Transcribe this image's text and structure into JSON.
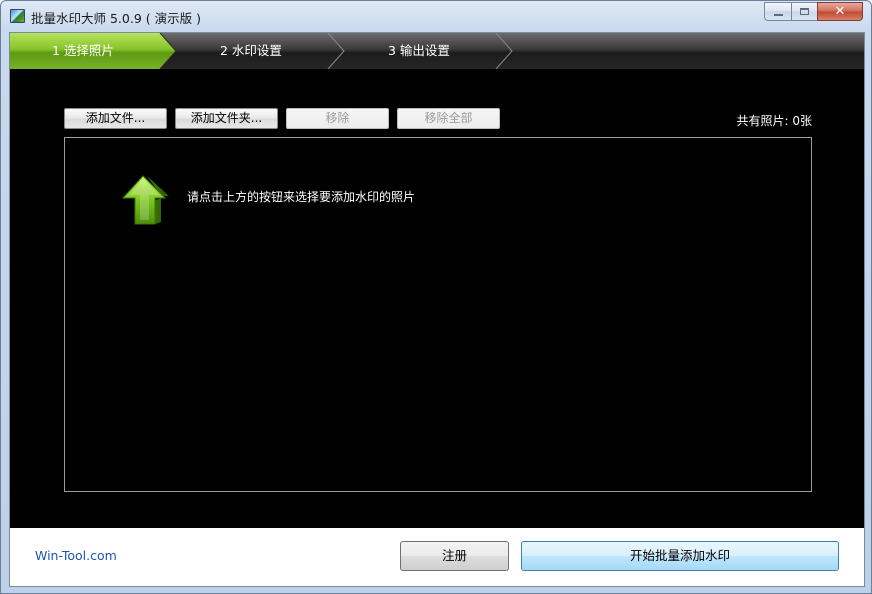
{
  "window": {
    "title": "批量水印大师 5.0.9 ( 演示版 )",
    "close_glyph": "✕"
  },
  "steps": [
    {
      "label": "1 选择照片",
      "active": true
    },
    {
      "label": "2 水印设置",
      "active": false
    },
    {
      "label": "3 输出设置",
      "active": false
    }
  ],
  "toolbar": {
    "add_files": "添加文件...",
    "add_folder": "添加文件夹...",
    "remove": "移除",
    "remove_all": "移除全部",
    "photo_count": "共有照片: 0张"
  },
  "list": {
    "hint": "请点击上方的按钮来选择要添加水印的照片",
    "hint_icon": "up-arrow-icon"
  },
  "footer": {
    "link": "Win-Tool.com",
    "register": "注册",
    "start": "开始批量添加水印"
  },
  "colors": {
    "accent_green": "#7dc61e",
    "link_blue": "#1d55b8"
  }
}
